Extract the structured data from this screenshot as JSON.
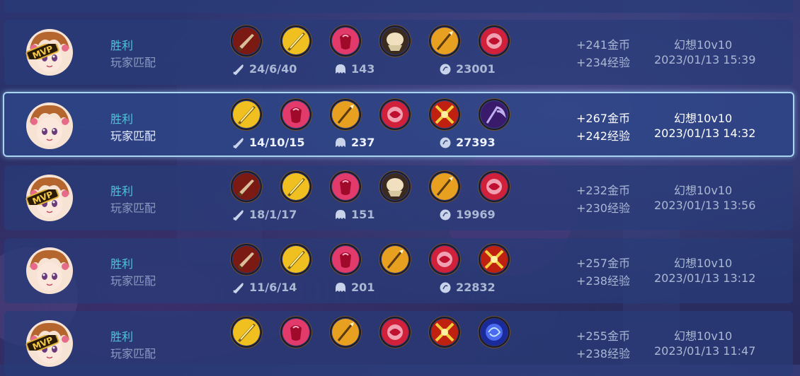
{
  "rows": [
    {
      "result": "胜利",
      "mode": "玩家匹配",
      "mvp": true,
      "kda": "24/6/40",
      "cs": "143",
      "gold_total": "23001",
      "gold_reward": "+241金币",
      "exp_reward": "+234经验",
      "game": "幻想10v10",
      "time": "2023/01/13 15:39",
      "items": [
        "dagger-item",
        "golden-sword-item",
        "red-crystal-item",
        "fist-item",
        "spear-item",
        "red-orb-item"
      ]
    },
    {
      "result": "胜利",
      "mode": "玩家匹配",
      "mvp": false,
      "selected": true,
      "kda": "14/10/15",
      "cs": "237",
      "gold_total": "27393",
      "gold_reward": "+267金币",
      "exp_reward": "+242经验",
      "game": "幻想10v10",
      "time": "2023/01/13 14:32",
      "items": [
        "golden-sword-item",
        "red-crystal-item",
        "spear-item",
        "red-orb-item",
        "cross-blade-item",
        "scythe-item"
      ]
    },
    {
      "result": "胜利",
      "mode": "玩家匹配",
      "mvp": true,
      "kda": "18/1/17",
      "cs": "151",
      "gold_total": "19969",
      "gold_reward": "+232金币",
      "exp_reward": "+230经验",
      "game": "幻想10v10",
      "time": "2023/01/13 13:56",
      "items": [
        "dagger-item",
        "golden-sword-item",
        "red-crystal-item",
        "fist-item",
        "spear-item",
        "red-orb-item"
      ]
    },
    {
      "result": "胜利",
      "mode": "玩家匹配",
      "mvp": false,
      "kda": "11/6/14",
      "cs": "201",
      "gold_total": "22832",
      "gold_reward": "+257金币",
      "exp_reward": "+238经验",
      "game": "幻想10v10",
      "time": "2023/01/13 13:12",
      "items": [
        "dagger-item",
        "golden-sword-item",
        "red-crystal-item",
        "spear-item",
        "red-orb-item",
        "cross-blade-item"
      ]
    },
    {
      "result": "胜利",
      "mode": "玩家匹配",
      "mvp": true,
      "kda": "",
      "cs": "",
      "gold_total": "",
      "gold_reward": "+255金币",
      "exp_reward": "+238经验",
      "game": "幻想10v10",
      "time": "2023/01/13 11:47",
      "items": [
        "golden-sword-item",
        "red-crystal-item",
        "spear-item",
        "red-orb-item",
        "cross-blade-item",
        "blue-orb-item"
      ]
    }
  ],
  "icons": {
    "kill": "sword-icon",
    "cs": "minion-icon",
    "gold": "coin-icon",
    "mvp_badge": "mvp-badge-icon"
  },
  "mvp_label": "MVP",
  "colors": {
    "win": "#4fc3d9",
    "selected_border": "#a8d4f0"
  }
}
